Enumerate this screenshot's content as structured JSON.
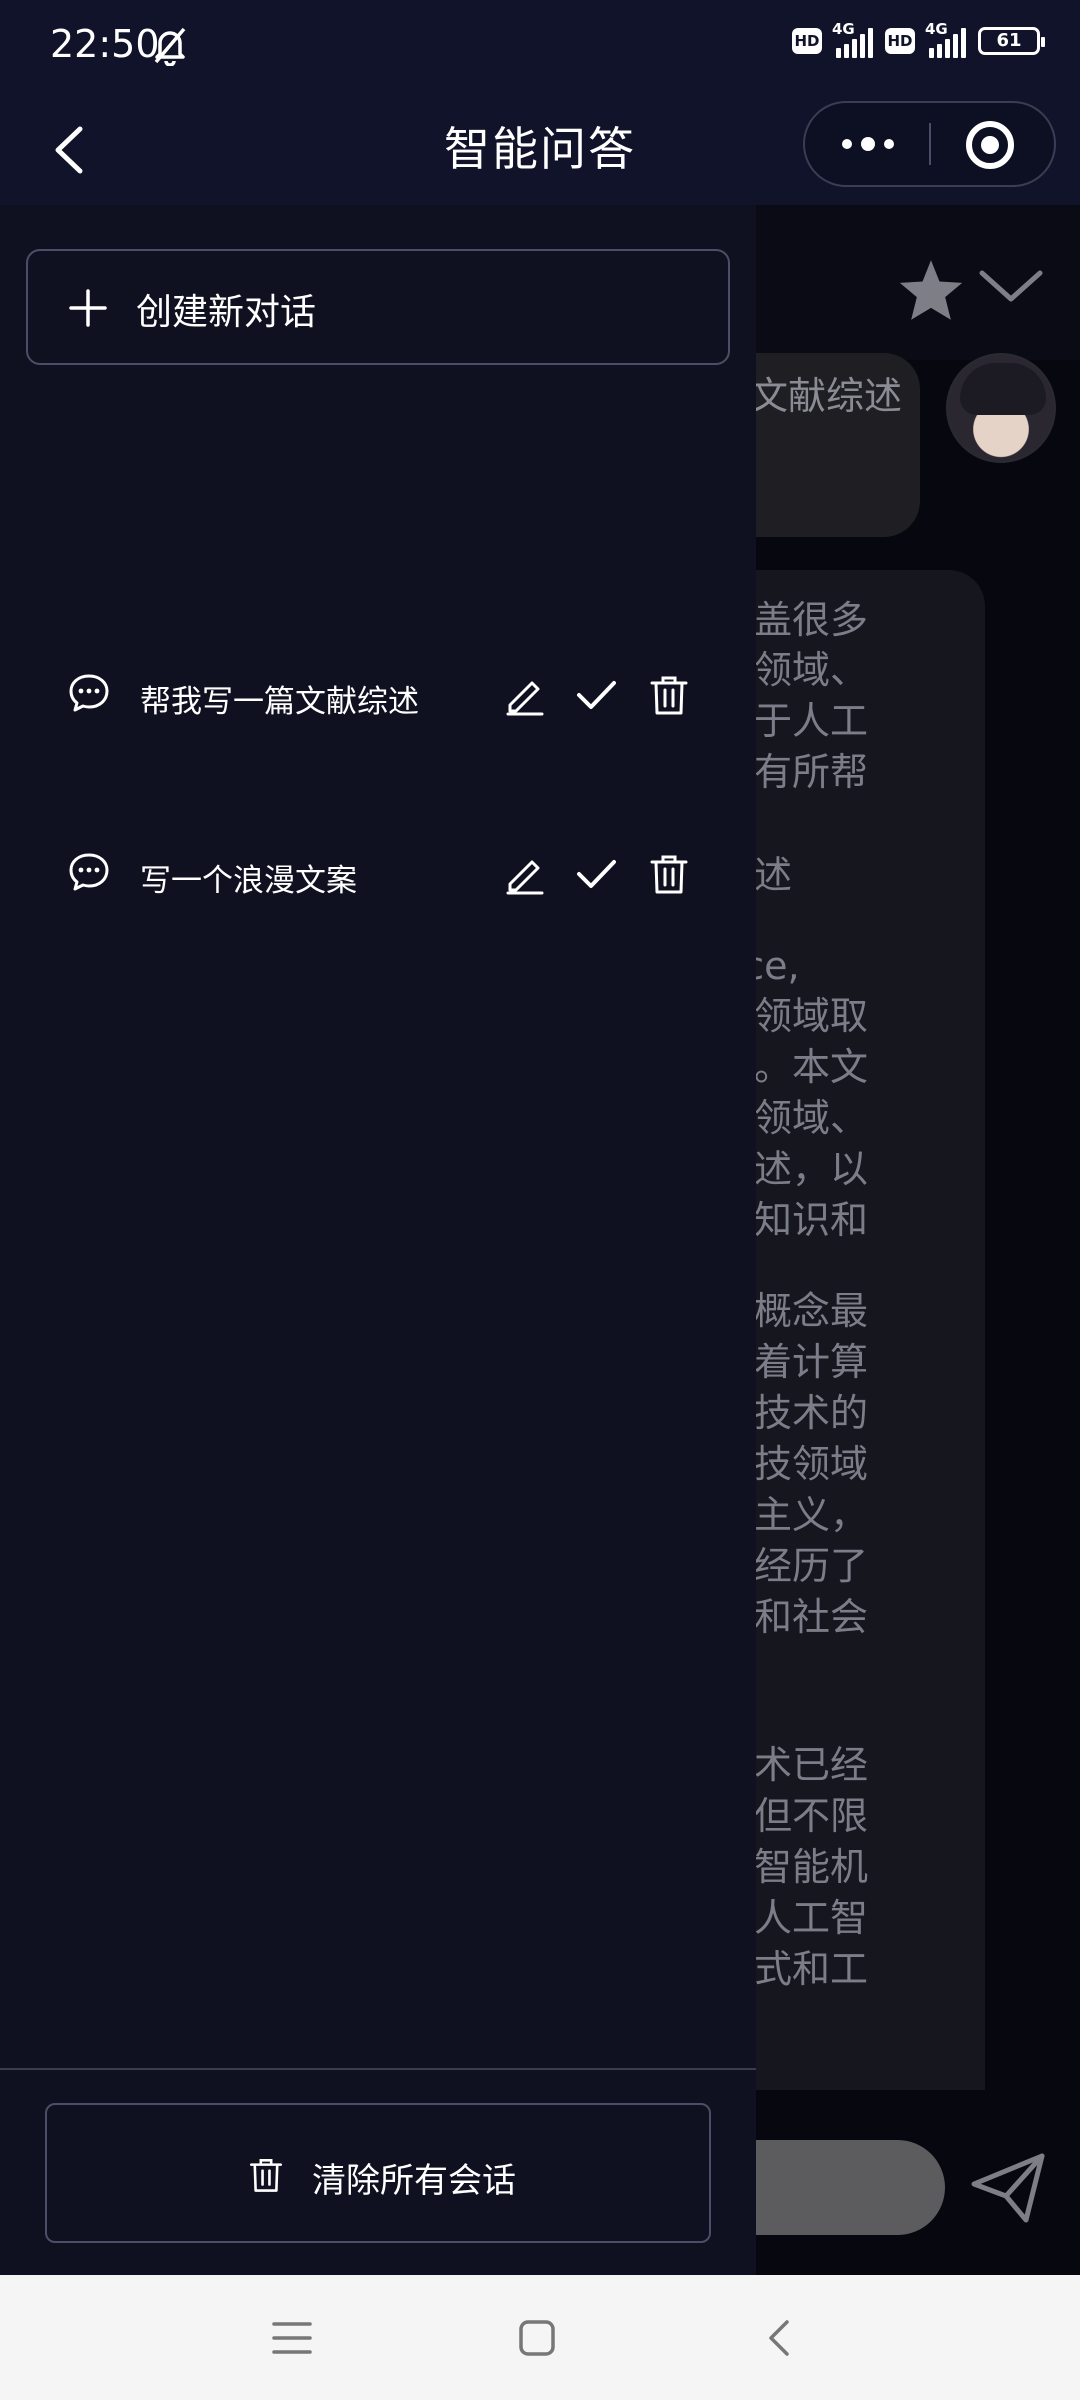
{
  "status_bar": {
    "time": "22:50",
    "network_labels": [
      "HD",
      "4G",
      "HD",
      "4G"
    ],
    "battery": "61"
  },
  "header": {
    "title": "智能问答"
  },
  "drawer": {
    "new_chat_label": "创建新对话",
    "conversations": [
      {
        "title": "帮我写一篇文献综述"
      },
      {
        "title": "写一个浪漫文案"
      }
    ],
    "clear_all_label": "清除所有会话"
  },
  "background_chat": {
    "user_message_visible": "文献综述",
    "ai_lines": [
      "可以涵盖很多",
      "、应用领域、",
      "一篇关于人工",
      "望对你有所帮",
      "",
      "文献综述",
      "",
      "lligence,",
      "在各个领域取",
      "和讨论。本文",
      "要应用领域、",
      "进行综述，以",
      "的基础知识和",
      "",
      "智能的概念最",
      "纪，随着计算",
      "学习等技术的",
      "当今科技领域",
      "和连接主义，",
      "的发展经历了",
      "技创新和社会",
      "",
      "智能技术已经",
      "，包括但不限",
      "视觉、智能机",
      "等等。人工智",
      "生活方式和工"
    ]
  },
  "colors": {
    "drawer_bg": "#0f1120",
    "header_bg": "#11132a",
    "nav_bar_bg": "#f5f5f5"
  }
}
